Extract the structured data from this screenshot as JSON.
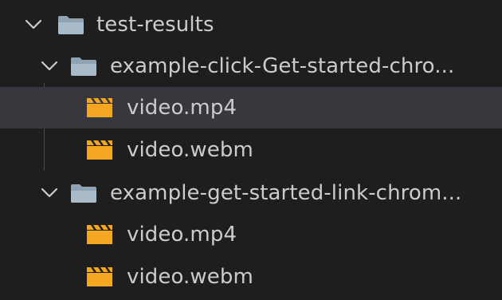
{
  "explorer": {
    "root": {
      "label": "test-results",
      "icon": "folder-open-icon",
      "expanded": true,
      "children": [
        {
          "label": "example-click-Get-started-chro...",
          "icon": "folder-open-icon",
          "expanded": true,
          "files": [
            {
              "label": "video.mp4",
              "icon": "video-file-icon",
              "selected": true
            },
            {
              "label": "video.webm",
              "icon": "video-file-icon",
              "selected": false
            }
          ]
        },
        {
          "label": "example-get-started-link-chrom...",
          "icon": "folder-open-icon",
          "expanded": true,
          "files": [
            {
              "label": "video.mp4",
              "icon": "video-file-icon",
              "selected": false
            },
            {
              "label": "video.webm",
              "icon": "video-file-icon",
              "selected": false
            }
          ]
        }
      ]
    }
  },
  "colors": {
    "background": "#1e1e1f",
    "selected_row": "#37373d",
    "text": "#cccccc",
    "folder": "#8fa3b4",
    "video_icon": "#f5a623"
  }
}
